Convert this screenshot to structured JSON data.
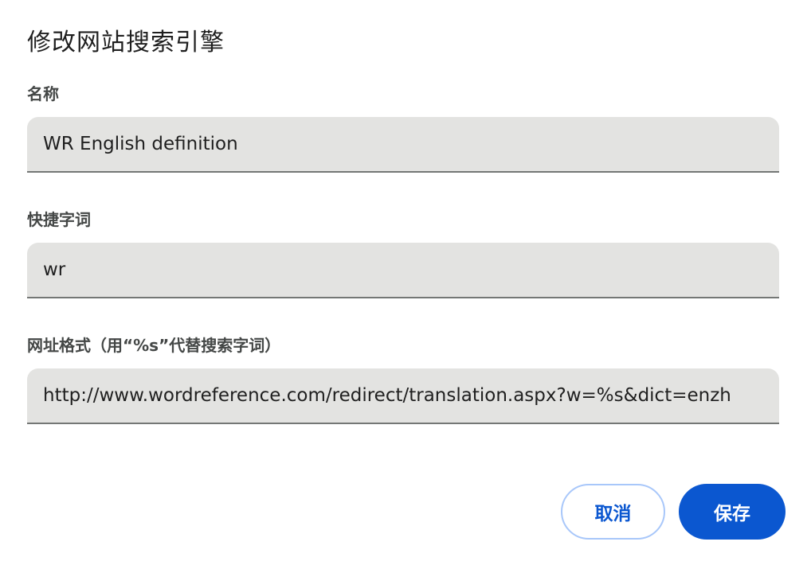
{
  "dialog": {
    "title": "修改网站搜索引擎",
    "fields": [
      {
        "label": "名称",
        "value": "WR English definition"
      },
      {
        "label": "快捷字词",
        "value": "wr"
      },
      {
        "label": "网址格式（用“%s”代替搜索字词）",
        "value": "http://www.wordreference.com/redirect/translation.aspx?w=%s&dict=enzh"
      }
    ],
    "buttons": {
      "cancel": "取消",
      "save": "保存"
    }
  },
  "colors": {
    "primary": "#0b57d0",
    "field_bg": "#e3e3e1",
    "cancel_border": "#a8c7fa"
  }
}
